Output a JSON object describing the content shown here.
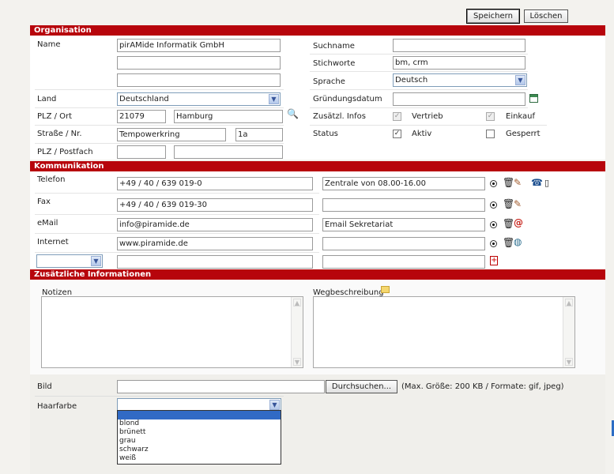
{
  "toolbar": {
    "save_label": "Speichern",
    "delete_label": "Löschen"
  },
  "sections": {
    "organisation": "Organisation",
    "kommunikation": "Kommunikation",
    "zusatz": "Zusätzliche Informationen"
  },
  "org": {
    "name_label": "Name",
    "name_1": "pirAMide Informatik GmbH",
    "name_2": "",
    "name_3": "",
    "land_label": "Land",
    "land_value": "Deutschland",
    "plzort_label": "PLZ / Ort",
    "plz": "21079",
    "ort": "Hamburg",
    "strasse_label": "Straße / Nr.",
    "strasse": "Tempowerkring",
    "nr": "1a",
    "postfach_label": "PLZ / Postfach",
    "suchname_label": "Suchname",
    "suchname": "",
    "stichworte_label": "Stichworte",
    "stichworte": "bm, crm",
    "sprache_label": "Sprache",
    "sprache": "Deutsch",
    "gruendung_label": "Gründungsdatum",
    "gruendung": "",
    "zusatzinfos_label": "Zusätzl. Infos",
    "vertrieb_label": "Vertrieb",
    "einkauf_label": "Einkauf",
    "status_label": "Status",
    "aktiv_label": "Aktiv",
    "gesperrt_label": "Gesperrt"
  },
  "komm": {
    "rows": [
      {
        "label": "Telefon",
        "value": "+49 / 40 / 639 019-0",
        "note": "Zentrale von 08.00-16.00"
      },
      {
        "label": "Fax",
        "value": "+49 / 40 / 639 019-30",
        "note": ""
      },
      {
        "label": "eMail",
        "value": "info@piramide.de",
        "note": "Email Sekretariat"
      },
      {
        "label": "Internet",
        "value": "www.piramide.de",
        "note": ""
      }
    ],
    "new_type": "",
    "new_value": "",
    "new_note": ""
  },
  "zusatz": {
    "notizen_label": "Notizen",
    "weg_label": "Wegbeschreibung",
    "bild_label": "Bild",
    "browse_label": "Durchsuchen...",
    "bild_hint": "(Max. Größe: 200 KB / Formate: gif, jpeg)",
    "haarfarbe_label": "Haarfarbe",
    "haarfarbe_value": "",
    "haarfarbe_options": [
      "",
      "blond",
      "brünett",
      "grau",
      "schwarz",
      "weiß"
    ]
  },
  "colors": {
    "accent": "#b7050c",
    "select_highlight": "#316ac5"
  },
  "icons": [
    "search-icon",
    "calendar-icon",
    "trash-icon",
    "edit-icon",
    "phone-icon",
    "mobile-icon",
    "email-icon",
    "globe-icon",
    "add-icon",
    "note-icon"
  ]
}
